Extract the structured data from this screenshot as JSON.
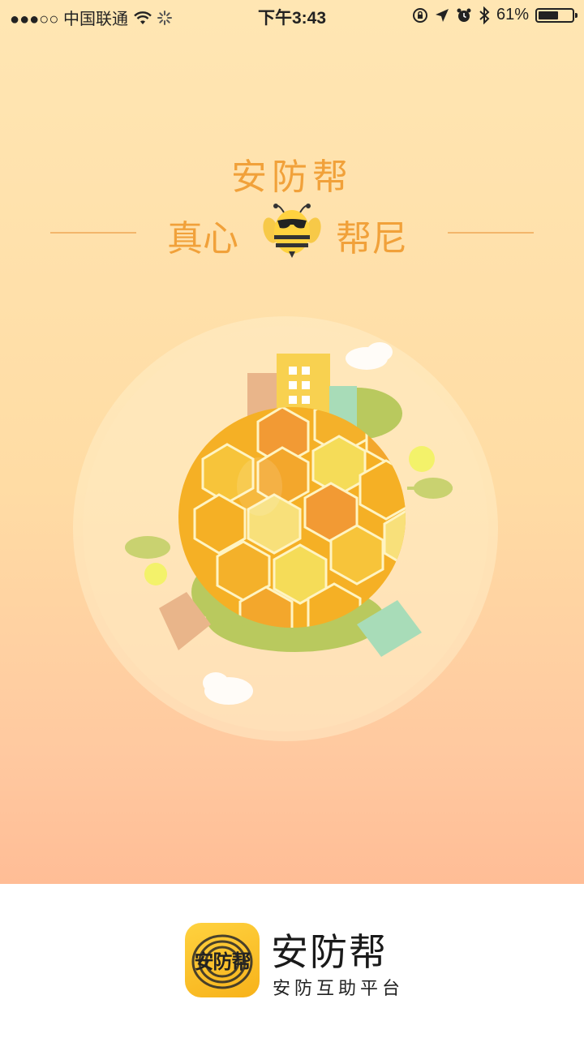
{
  "status_bar": {
    "carrier": "●●●○○ 中国联通",
    "time": "下午3:43",
    "battery_percent": "61%",
    "battery_level": 0.61,
    "icons": [
      "signal-dots-icon",
      "wifi-icon",
      "loading-spinner-icon",
      "rotation-lock-icon",
      "location-arrow-icon",
      "alarm-icon",
      "bluetooth-icon",
      "battery-icon"
    ]
  },
  "splash": {
    "title": "安防帮",
    "slogan_left": "真心",
    "slogan_right": "帮尼",
    "mascot": "bee-mascot-icon",
    "illustration": "honeycomb-globe-illustration"
  },
  "footer": {
    "logo_text": "安防帮",
    "brand_name": "安防帮",
    "tagline": "安防互助平台"
  },
  "colors": {
    "accent": "#f1a13a",
    "bg_top": "#ffe6b3",
    "bg_bottom": "#ffbd96",
    "footer_bg": "#ffffff"
  }
}
